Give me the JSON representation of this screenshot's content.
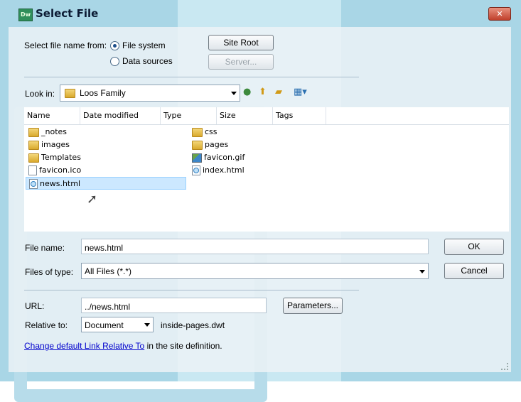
{
  "dialog": {
    "title": "Select File",
    "logo": "Dw"
  },
  "select_from": {
    "label": "Select file name from:",
    "options": [
      {
        "label": "File system",
        "selected": true
      },
      {
        "label": "Data sources",
        "selected": false
      }
    ]
  },
  "buttons": {
    "site_root": "Site Root",
    "server": "Server...",
    "ok": "OK",
    "cancel": "Cancel",
    "parameters": "Parameters..."
  },
  "look_in": {
    "label": "Look in:",
    "value": "Loos Family"
  },
  "toolbar_icons": [
    "back-icon",
    "up-folder-icon",
    "new-folder-icon",
    "views-menu-icon"
  ],
  "columns": [
    "Name",
    "Date modified",
    "Type",
    "Size",
    "Tags"
  ],
  "files": {
    "col1": [
      {
        "name": "_notes",
        "kind": "folder"
      },
      {
        "name": "images",
        "kind": "folder"
      },
      {
        "name": "Templates",
        "kind": "folder"
      },
      {
        "name": "favicon.ico",
        "kind": "file"
      },
      {
        "name": "news.html",
        "kind": "html",
        "selected": true
      }
    ],
    "col2": [
      {
        "name": "css",
        "kind": "folder"
      },
      {
        "name": "pages",
        "kind": "folder"
      },
      {
        "name": "favicon.gif",
        "kind": "image"
      },
      {
        "name": "index.html",
        "kind": "html"
      }
    ]
  },
  "file_name": {
    "label": "File name:",
    "value": "news.html"
  },
  "files_of_type": {
    "label": "Files of type:",
    "value": "All Files (*.*)"
  },
  "url": {
    "label": "URL:",
    "value": "../news.html"
  },
  "relative_to": {
    "label": "Relative to:",
    "value": "Document",
    "file": "inside-pages.dwt"
  },
  "footer": {
    "link": "Change default Link Relative To",
    "rest": " in the site definition."
  },
  "colors": {
    "close_button": "#c0402c",
    "link": "#0000cc",
    "selection": "#cce8ff"
  }
}
